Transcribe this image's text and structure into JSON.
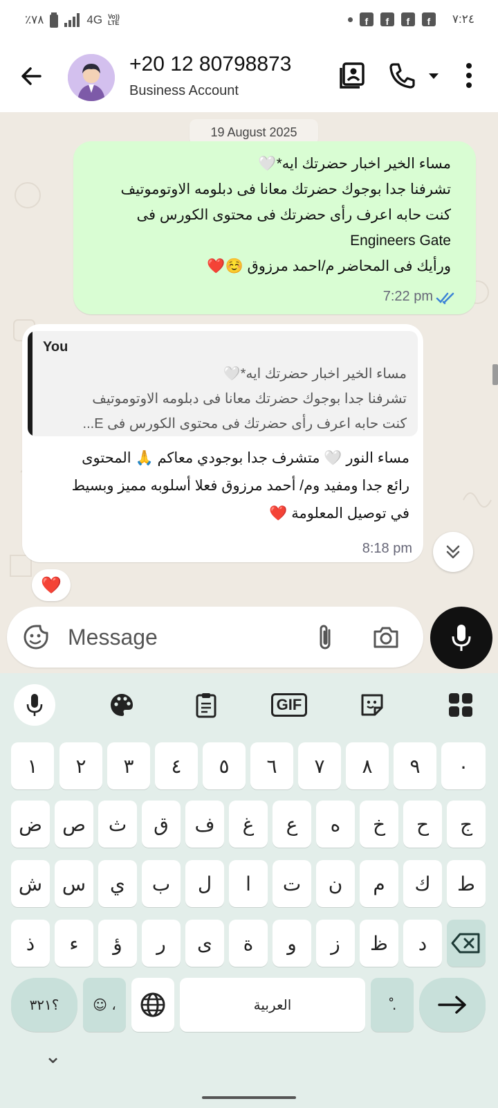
{
  "status_bar": {
    "battery": "٪٧٨",
    "network": "4G",
    "volte": "Vo)) LTE",
    "time": "٧:٢٤",
    "notif_icon": "f"
  },
  "header": {
    "contact_name": "+20 12 80798873",
    "subtitle": "Business Account"
  },
  "chat": {
    "date_chip": "19 August 2025",
    "outgoing": {
      "lines": [
        "مساء الخير اخبار حضرتك ايه*🤍",
        "تشرفنا جدا بوجوك حضرتك معانا فى دبلومه الاوتوموتيف",
        "كنت حابه اعرف رأى حضرتك فى محتوى الكورس فى",
        "Engineers Gate",
        "ورأيك فى المحاضر م/احمد مرزوق ☺️❤️"
      ],
      "time": "7:22 pm"
    },
    "incoming": {
      "quote_author": "You",
      "quote_lines": [
        "مساء الخير اخبار حضرتك ايه*🤍",
        "تشرفنا جدا بوجوك حضرتك معانا فى دبلومه الاوتوموتيف",
        "كنت حابه اعرف رأى حضرتك فى محتوى الكورس فى E..."
      ],
      "lines": [
        "مساء النور 🤍 متشرف جدا بوجودي معاكم 🙏 المحتوى",
        "رائع جدا ومفيد وم/ أحمد مرزوق فعلا أسلوبه مميز وبسيط",
        "في توصيل المعلومة ❤️"
      ],
      "time": "8:18 pm"
    },
    "reaction": "❤️"
  },
  "input": {
    "placeholder": "Message"
  },
  "keyboard": {
    "gif_label": "GIF",
    "row_numbers": [
      "١",
      "٢",
      "٣",
      "٤",
      "٥",
      "٦",
      "٧",
      "٨",
      "٩",
      "٠"
    ],
    "row1": [
      "ض",
      "ص",
      "ث",
      "ق",
      "ف",
      "غ",
      "ع",
      "ه",
      "خ",
      "ح",
      "ج"
    ],
    "row2": [
      "ش",
      "س",
      "ي",
      "ب",
      "ل",
      "ا",
      "ت",
      "ن",
      "م",
      "ك",
      "ط"
    ],
    "row3": [
      "ذ",
      "ء",
      "ؤ",
      "ر",
      "ى",
      "ة",
      "و",
      "ز",
      "ظ",
      "د"
    ],
    "symbols_label": "؟٣٢١",
    "emoji_label": "☺ ،",
    "space_label": "العربية",
    "diacritic_label": "ْ .",
    "hide_label": "⌄"
  }
}
